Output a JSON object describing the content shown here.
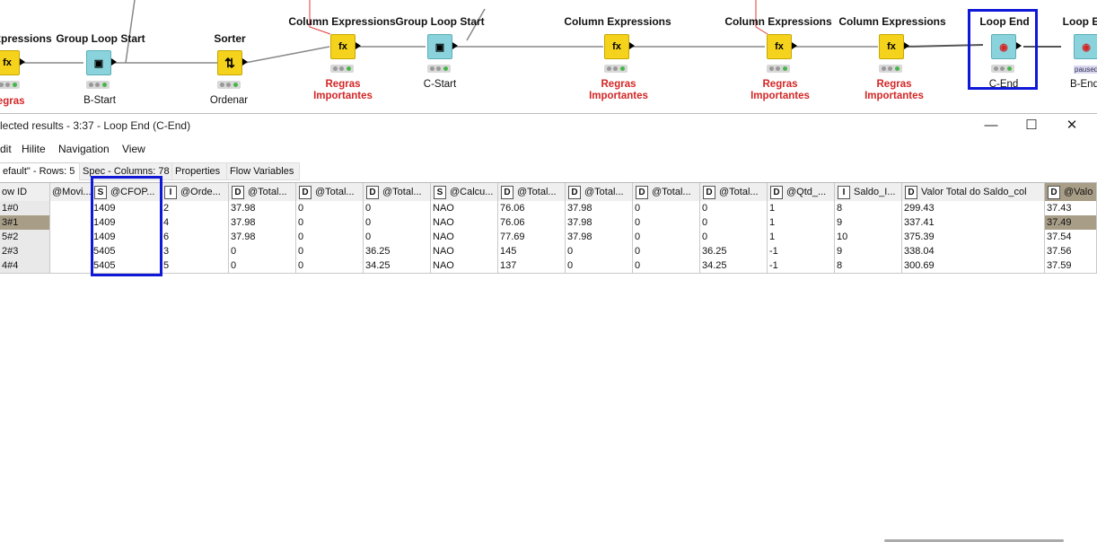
{
  "workflow": {
    "nodes": [
      {
        "id": "n0",
        "title": "Expressions",
        "label": "Regras",
        "label2": "",
        "label_color": "red",
        "icon_glyph": "fx",
        "color": "yellow",
        "type": "column-expressions"
      },
      {
        "id": "n1",
        "title": "Group Loop Start",
        "label": "B-Start",
        "label2": "",
        "label_color": "black",
        "icon_glyph": "▣",
        "color": "teal",
        "type": "group-loop-start"
      },
      {
        "id": "n2",
        "title": "Sorter",
        "label": "Ordenar",
        "label2": "",
        "label_color": "black",
        "icon_glyph": "⇅",
        "color": "yellow",
        "type": "sorter"
      },
      {
        "id": "n3",
        "title": "Column Expressions",
        "label": "Regras",
        "label2": "Importantes",
        "label_color": "red",
        "icon_glyph": "fx",
        "color": "yellow",
        "type": "column-expressions"
      },
      {
        "id": "n4",
        "title": "Group Loop Start",
        "label": "C-Start",
        "label2": "",
        "label_color": "black",
        "icon_glyph": "▣",
        "color": "teal",
        "type": "group-loop-start"
      },
      {
        "id": "n5",
        "title": "Column Expressions",
        "label": "Regras",
        "label2": "Importantes",
        "label_color": "red",
        "icon_glyph": "fx",
        "color": "yellow",
        "type": "column-expressions"
      },
      {
        "id": "n6",
        "title": "Column Expressions",
        "label": "Regras",
        "label2": "Importantes",
        "label_color": "red",
        "icon_glyph": "fx",
        "color": "yellow",
        "type": "column-expressions"
      },
      {
        "id": "n7",
        "title": "Column Expressions",
        "label": "Regras",
        "label2": "Importantes",
        "label_color": "red",
        "icon_glyph": "fx",
        "color": "yellow",
        "type": "column-expressions"
      },
      {
        "id": "n8",
        "title": "Loop End",
        "label": "C-End",
        "label2": "",
        "label_color": "black",
        "icon_glyph": "◉",
        "color": "teal",
        "type": "loop-end"
      },
      {
        "id": "n9",
        "title": "Loop E",
        "label": "B-End",
        "label2": "",
        "label_color": "black",
        "icon_glyph": "◉",
        "color": "teal",
        "type": "loop-end",
        "badge": "paused"
      }
    ]
  },
  "window": {
    "title": "lected results - 3:37 - Loop End (C-End)",
    "minimize_icon": "minimize-icon",
    "maximize_icon": "maximize-icon",
    "close_icon": "close-icon"
  },
  "menu": [
    "dit",
    "Hilite",
    "Navigation",
    "View"
  ],
  "tabs": [
    {
      "label": "efault\" - Rows: 5",
      "active": true
    },
    {
      "label": "Spec - Columns: 78",
      "active": false
    },
    {
      "label": "Properties",
      "active": false
    },
    {
      "label": "Flow Variables",
      "active": false
    }
  ],
  "table": {
    "columns": [
      {
        "type": "",
        "name": "ow ID"
      },
      {
        "type": "",
        "name": "@Movi..."
      },
      {
        "type": "S",
        "name": "@CFOP..."
      },
      {
        "type": "I",
        "name": "@Orde..."
      },
      {
        "type": "D",
        "name": "@Total..."
      },
      {
        "type": "D",
        "name": "@Total..."
      },
      {
        "type": "D",
        "name": "@Total..."
      },
      {
        "type": "S",
        "name": "@Calcu..."
      },
      {
        "type": "D",
        "name": "@Total..."
      },
      {
        "type": "D",
        "name": "@Total..."
      },
      {
        "type": "D",
        "name": "@Total..."
      },
      {
        "type": "D",
        "name": "@Total..."
      },
      {
        "type": "D",
        "name": "@Qtd_..."
      },
      {
        "type": "I",
        "name": "Saldo_I..."
      },
      {
        "type": "D",
        "name": "Valor Total do Saldo_col"
      },
      {
        "type": "D",
        "name": "@Valo"
      }
    ],
    "rows": [
      [
        "1#0",
        "",
        "1409",
        "2",
        "37.98",
        "0",
        "0",
        "NAO",
        "76.06",
        "37.98",
        "0",
        "0",
        "1",
        "8",
        "299.43",
        "37.43"
      ],
      [
        "3#1",
        "",
        "1409",
        "4",
        "37.98",
        "0",
        "0",
        "NAO",
        "76.06",
        "37.98",
        "0",
        "0",
        "1",
        "9",
        "337.41",
        "37.49"
      ],
      [
        "5#2",
        "",
        "1409",
        "6",
        "37.98",
        "0",
        "0",
        "NAO",
        "77.69",
        "37.98",
        "0",
        "0",
        "1",
        "10",
        "375.39",
        "37.54"
      ],
      [
        "2#3",
        "",
        "5405",
        "3",
        "0",
        "0",
        "36.25",
        "NAO",
        "145",
        "0",
        "0",
        "36.25",
        "-1",
        "9",
        "338.04",
        "37.56"
      ],
      [
        "4#4",
        "",
        "5405",
        "5",
        "0",
        "0",
        "34.25",
        "NAO",
        "137",
        "0",
        "0",
        "34.25",
        "-1",
        "8",
        "300.69",
        "37.59"
      ]
    ],
    "highlighted_row": 1,
    "selected_column": 2
  },
  "colors": {
    "accent": "#1018d8",
    "node_yellow": "#f5d21b",
    "node_teal": "#8ad3dc",
    "label_red": "#d32626",
    "highlight": "#a89d86"
  }
}
